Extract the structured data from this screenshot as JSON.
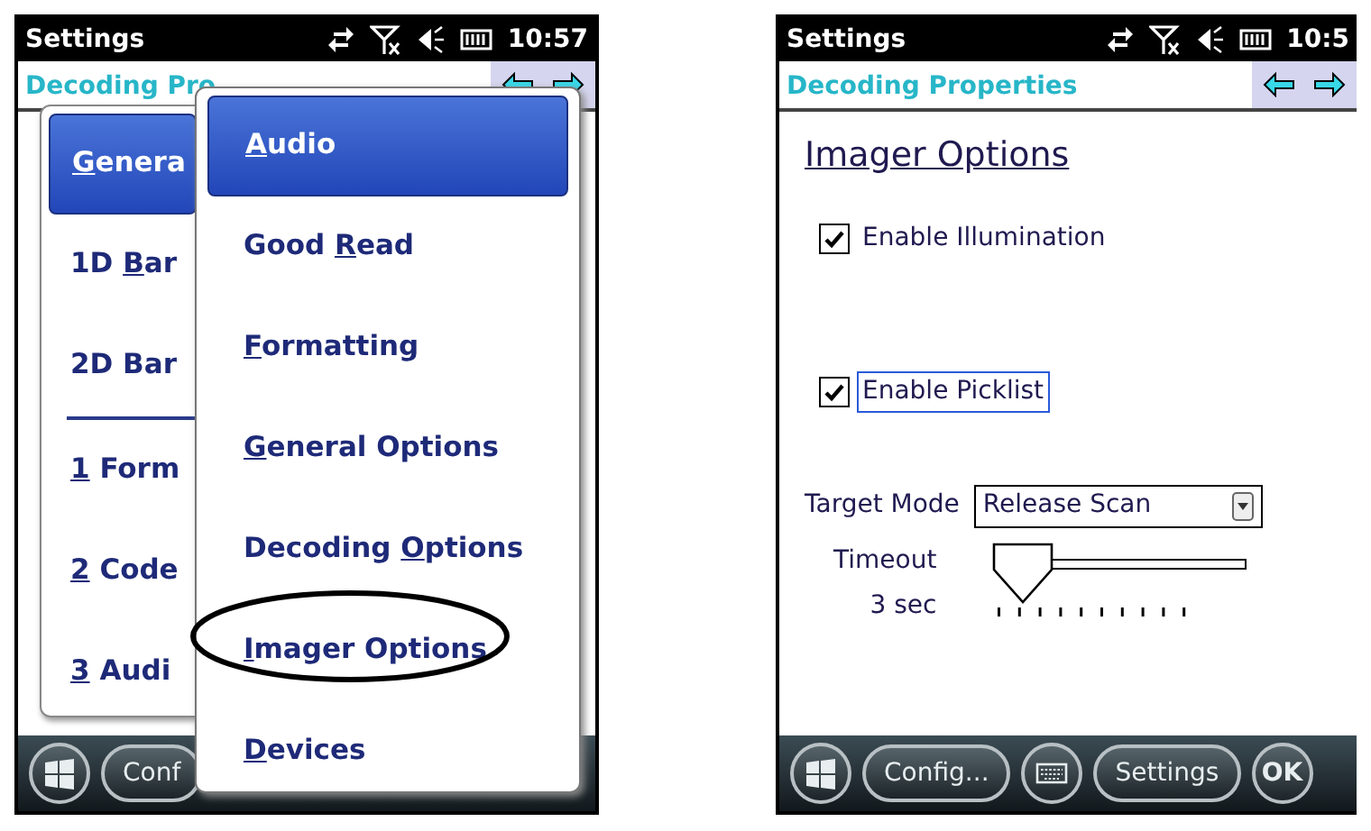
{
  "left_screen": {
    "status_bar": {
      "title": "Settings",
      "time": "10:57"
    },
    "header": {
      "title": "Decoding Pro"
    },
    "menu": {
      "items": [
        {
          "kind": "item",
          "selected": true,
          "label": [
            {
              "text": "G",
              "underlined": true
            },
            {
              "text": "enera",
              "underlined": false
            }
          ]
        },
        {
          "kind": "item",
          "selected": false,
          "label": [
            {
              "text": "1D ",
              "underlined": false
            },
            {
              "text": "B",
              "underlined": true
            },
            {
              "text": "ar",
              "underlined": false
            }
          ]
        },
        {
          "kind": "item",
          "selected": false,
          "label": [
            {
              "text": "2D Bar",
              "underlined": false
            }
          ]
        },
        {
          "kind": "divider"
        },
        {
          "kind": "item",
          "selected": false,
          "label": [
            {
              "text": "1",
              "underlined": true
            },
            {
              "text": " Form",
              "underlined": false
            }
          ]
        },
        {
          "kind": "item",
          "selected": false,
          "label": [
            {
              "text": "2",
              "underlined": true
            },
            {
              "text": " Code",
              "underlined": false
            }
          ]
        },
        {
          "kind": "item",
          "selected": false,
          "label": [
            {
              "text": "3",
              "underlined": true
            },
            {
              "text": " Audi",
              "underlined": false
            }
          ]
        }
      ]
    },
    "submenu": {
      "items": [
        {
          "selected": true,
          "circled": false,
          "label": [
            {
              "text": "A",
              "underlined": true
            },
            {
              "text": "udio",
              "underlined": false
            }
          ]
        },
        {
          "selected": false,
          "circled": false,
          "label": [
            {
              "text": "Good ",
              "underlined": false
            },
            {
              "text": "R",
              "underlined": true
            },
            {
              "text": "ead",
              "underlined": false
            }
          ]
        },
        {
          "selected": false,
          "circled": false,
          "label": [
            {
              "text": "F",
              "underlined": true
            },
            {
              "text": "ormatting",
              "underlined": false
            }
          ]
        },
        {
          "selected": false,
          "circled": false,
          "label": [
            {
              "text": "G",
              "underlined": true
            },
            {
              "text": "eneral Options",
              "underlined": false
            }
          ]
        },
        {
          "selected": false,
          "circled": false,
          "label": [
            {
              "text": "Decoding ",
              "underlined": false
            },
            {
              "text": "O",
              "underlined": true
            },
            {
              "text": "ptions",
              "underlined": false
            }
          ]
        },
        {
          "selected": false,
          "circled": true,
          "label": [
            {
              "text": "I",
              "underlined": true
            },
            {
              "text": "mager Options",
              "underlined": false
            }
          ]
        },
        {
          "selected": false,
          "circled": false,
          "label": [
            {
              "text": "D",
              "underlined": true
            },
            {
              "text": "evices",
              "underlined": false
            }
          ]
        }
      ]
    },
    "taskbar": [
      {
        "kind": "start"
      },
      {
        "kind": "text",
        "label": "Conf"
      }
    ]
  },
  "right_screen": {
    "status_bar": {
      "title": "Settings",
      "time": "10:5"
    },
    "header": {
      "title": "Decoding Properties"
    },
    "page_title": "Imager Options",
    "checkboxes": [
      {
        "label": "Enable Illumination",
        "checked": true,
        "focused": false
      },
      {
        "label": "Enable Picklist",
        "checked": true,
        "focused": true
      }
    ],
    "target_mode": {
      "label": "Target Mode",
      "value": "Release Scan"
    },
    "timeout": {
      "label": "Timeout",
      "reading": "3 sec",
      "level": 0.11
    },
    "taskbar": [
      {
        "kind": "start"
      },
      {
        "kind": "text",
        "label": "Config..."
      },
      {
        "kind": "keyboard"
      },
      {
        "kind": "text",
        "label": "Settings"
      },
      {
        "kind": "round",
        "label": "OK"
      }
    ]
  }
}
